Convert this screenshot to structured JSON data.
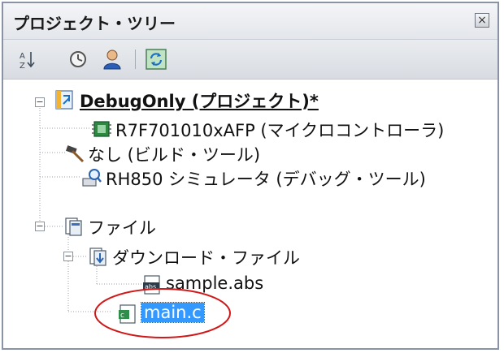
{
  "panel": {
    "title": "プロジェクト・ツリー",
    "close_glyph": "×"
  },
  "toolbar": {
    "buttons": [
      {
        "icon": "sort-icon"
      },
      {
        "icon": "clock-icon"
      },
      {
        "icon": "user-icon"
      },
      {
        "icon": "refresh-icon"
      }
    ]
  },
  "tree": {
    "project": {
      "label": "DebugOnly (プロジェクト)*",
      "expanded": true
    },
    "microcontroller": {
      "label": "R7F701010xAFP (マイクロコントローラ)"
    },
    "build_tool": {
      "label": "なし (ビルド・ツール)"
    },
    "debug_tool": {
      "label": "RH850 シミュレータ (デバッグ・ツール)"
    },
    "files": {
      "label": "ファイル",
      "expanded": true
    },
    "download_files": {
      "label": "ダウンロード・ファイル",
      "expanded": true
    },
    "sample_abs": {
      "label": "sample.abs"
    },
    "main_c": {
      "label": "main.c",
      "selected": true,
      "highlighted": true
    }
  },
  "colors": {
    "selection": "#3399ff",
    "highlight_ellipse": "#d01818"
  }
}
